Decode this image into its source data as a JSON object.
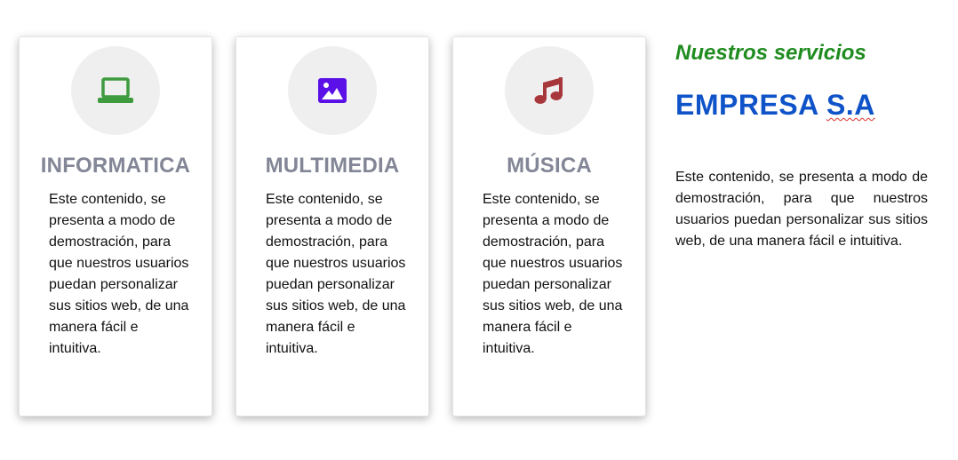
{
  "cards": [
    {
      "icon": "laptop-icon",
      "icon_color": "#3e9b3e",
      "title": "INFORMATICA",
      "text": "Este contenido, se presenta a modo de demostración, para que nuestros usuarios puedan personalizar sus sitios web, de una manera fácil e intuitiva."
    },
    {
      "icon": "image-icon",
      "icon_color": "#5a10e6",
      "title": "MULTIMEDIA",
      "text": "Este contenido, se presenta a modo de demostración, para que nuestros usuarios puedan personalizar sus sitios web, de una manera fácil e intuitiva."
    },
    {
      "icon": "music-note-icon",
      "icon_color": "#a8373b",
      "title": "MÚSICA",
      "text": "Este contenido, se presenta a modo de demostración, para que nuestros usuarios puedan personalizar sus sitios web, de una manera fácil e intuitiva."
    }
  ],
  "side": {
    "subtitle": "Nuestros servicios",
    "company_prefix": "EMPRESA ",
    "company_suffix": "S.A",
    "text": "Este contenido, se presenta a modo de demostración, para que nuestros usuarios puedan personalizar sus sitios web, de una manera fácil e intuitiva."
  },
  "colors": {
    "card_title": "#838696",
    "subtitle": "#1f8c1f",
    "company": "#0f53c9"
  }
}
